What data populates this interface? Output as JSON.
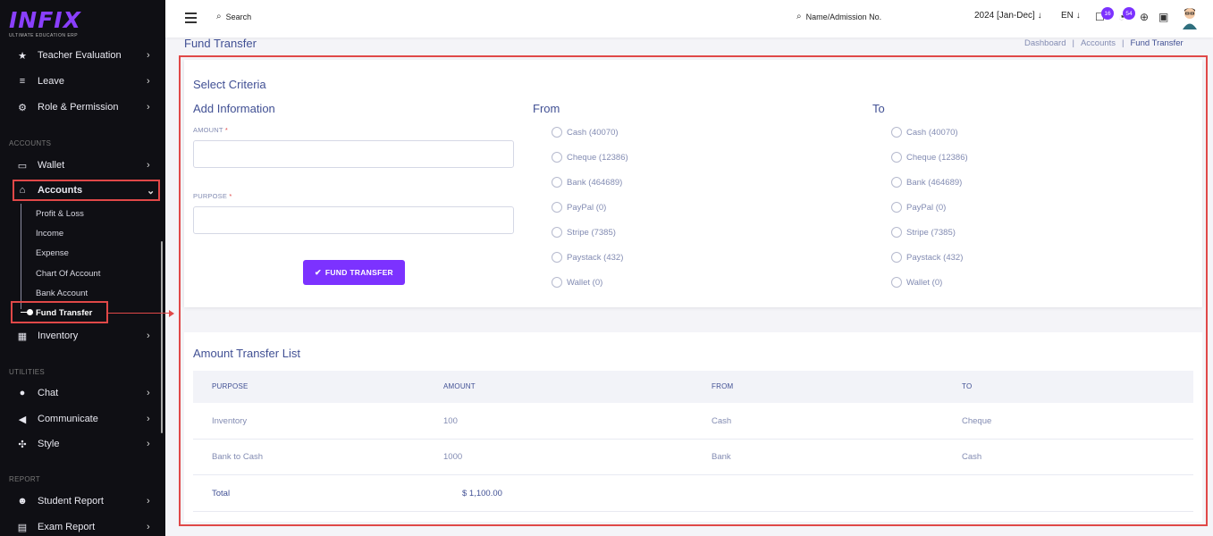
{
  "logo": {
    "brand": "INFIX",
    "tagline": "ULTIMATE EDUCATION ERP"
  },
  "sidebar": {
    "top_items": [
      {
        "label": "Teacher Evaluation",
        "icon": "star-icon"
      },
      {
        "label": "Leave",
        "icon": "bed-icon"
      },
      {
        "label": "Role & Permission",
        "icon": "key-icon"
      }
    ],
    "section_accounts": "ACCOUNTS",
    "wallet": "Wallet",
    "accounts": "Accounts",
    "accounts_sub": [
      "Profit & Loss",
      "Income",
      "Expense",
      "Chart Of Account",
      "Bank Account"
    ],
    "fund_transfer": "Fund Transfer",
    "inventory": "Inventory",
    "section_utilities": "UTILITIES",
    "chat": "Chat",
    "communicate": "Communicate",
    "style": "Style",
    "section_report": "REPORT",
    "student_report": "Student Report",
    "exam_report": "Exam Report"
  },
  "topbar": {
    "search_label": "Search",
    "name_search_label": "Name/Admission No.",
    "academic_year": "2024 [Jan-Dec]",
    "language": "EN",
    "chat_badge": "16",
    "notification_badge": "54"
  },
  "page": {
    "title": "Fund Transfer",
    "breadcrumb": [
      "Dashboard",
      "Accounts",
      "Fund Transfer"
    ]
  },
  "criteria": {
    "heading": "Select Criteria",
    "add_info": "Add Information",
    "amount_label": "AMOUNT",
    "purpose_label": "PURPOSE",
    "required_mark": "*",
    "amount_value": "",
    "purpose_value": "",
    "submit_label": "FUND TRANSFER",
    "from_heading": "From",
    "to_heading": "To",
    "from_options": [
      "Cash (40070)",
      "Cheque (12386)",
      "Bank (464689)",
      "PayPal (0)",
      "Stripe (7385)",
      "Paystack (432)",
      "Wallet (0)"
    ],
    "to_options": [
      "Cash (40070)",
      "Cheque (12386)",
      "Bank (464689)",
      "PayPal (0)",
      "Stripe (7385)",
      "Paystack (432)",
      "Wallet (0)"
    ]
  },
  "transfer_list": {
    "heading": "Amount Transfer List",
    "columns": [
      "PURPOSE",
      "AMOUNT",
      "FROM",
      "TO"
    ],
    "rows": [
      {
        "purpose": "Inventory",
        "amount": "100",
        "from": "Cash",
        "to": "Cheque"
      },
      {
        "purpose": "Bank to Cash",
        "amount": "1000",
        "from": "Bank",
        "to": "Cash"
      }
    ],
    "total_label": "Total",
    "total_value": "$ 1,100.00"
  },
  "colors": {
    "accent": "#7c32ff",
    "sidebar_bg": "#0f0f14",
    "highlight_border": "#e04848",
    "heading_text": "#415094"
  }
}
